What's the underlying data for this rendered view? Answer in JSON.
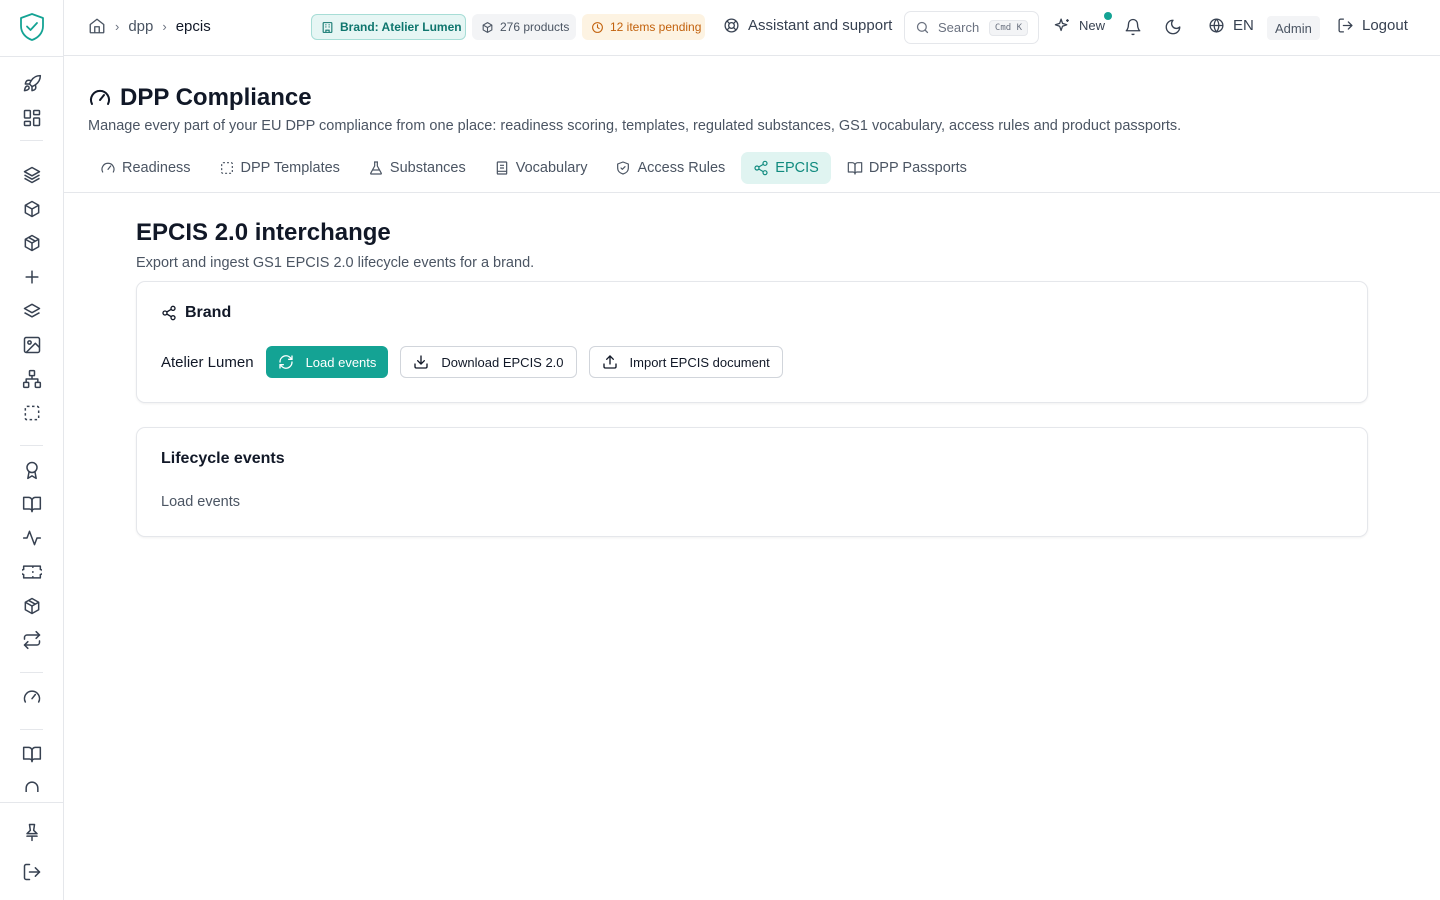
{
  "app": {
    "brand_color": "#14a394"
  },
  "breadcrumb": {
    "items": [
      "dpp",
      "epcis"
    ]
  },
  "topbar": {
    "brand_pill": "Brand: Atelier Lumen",
    "products_pill": "276 products",
    "pending_pill": "12 items pending",
    "assistant": "Assistant and support",
    "search_placeholder": "Search",
    "search_shortcut": "Cmd K",
    "new_label": "New",
    "language": "EN",
    "role": "Admin",
    "logout": "Logout"
  },
  "header": {
    "title": "DPP Compliance",
    "subtitle": "Manage every part of your EU DPP compliance from one place: readiness scoring, templates, regulated substances, GS1 vocabulary, access rules and product passports.",
    "tabs": [
      {
        "label": "Readiness",
        "icon": "gauge-icon"
      },
      {
        "label": "DPP Templates",
        "icon": "dashed-square-icon"
      },
      {
        "label": "Substances",
        "icon": "flask-icon"
      },
      {
        "label": "Vocabulary",
        "icon": "book-icon"
      },
      {
        "label": "Access Rules",
        "icon": "shield-icon"
      },
      {
        "label": "EPCIS",
        "icon": "share-icon",
        "active": true
      },
      {
        "label": "DPP Passports",
        "icon": "open-book-icon"
      }
    ]
  },
  "main": {
    "title": "EPCIS 2.0 interchange",
    "subtitle": "Export and ingest GS1 EPCIS 2.0 lifecycle events for a brand.",
    "brand_card": {
      "heading": "Brand",
      "brand_name": "Atelier Lumen",
      "load_button": "Load events",
      "download_button": "Download EPCIS 2.0",
      "import_button": "Import EPCIS document"
    },
    "events_card": {
      "heading": "Lifecycle events",
      "empty_text": "Load events"
    }
  }
}
